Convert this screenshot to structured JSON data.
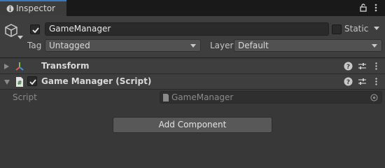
{
  "tab": {
    "label": "Inspector"
  },
  "game_object": {
    "active": true,
    "name": "GameManager",
    "static_label": "Static",
    "static": false,
    "tag_label": "Tag",
    "tag_value": "Untagged",
    "layer_label": "Layer",
    "layer_value": "Default"
  },
  "components": [
    {
      "title": "Transform",
      "expanded": false
    },
    {
      "title": "Game Manager (Script)",
      "expanded": true,
      "enabled": true
    }
  ],
  "script_field": {
    "label": "Script",
    "value": "GameManager"
  },
  "add_component_label": "Add Component",
  "colors": {
    "tab_accent": "#3a79bb",
    "panel_bg": "#383838",
    "header_bg": "#3e3e3e"
  }
}
